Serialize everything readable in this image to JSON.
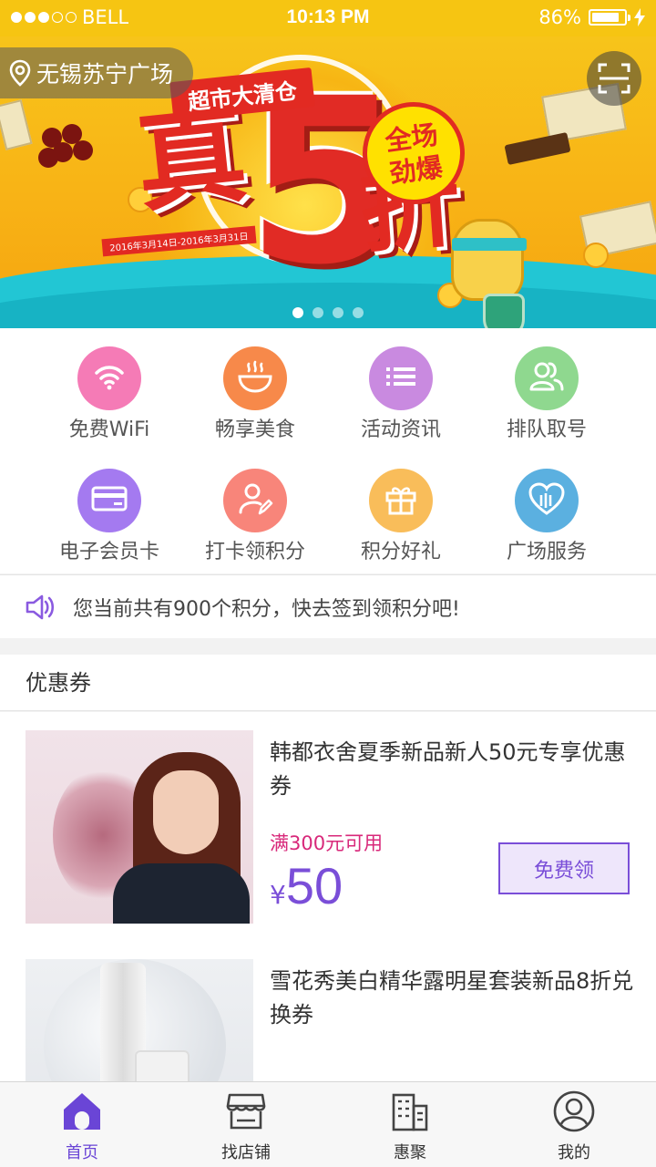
{
  "status_bar": {
    "carrier": "BELL",
    "signal_dots_filled": 3,
    "signal_dots_total": 5,
    "time": "10:13 PM",
    "battery_percent": "86%",
    "battery_level": 0.86
  },
  "banner": {
    "location": "无锡苏宁广场",
    "ribbon_text": "超市大清仓",
    "headline_zhen": "真",
    "headline_five": "5",
    "headline_zhe": "折",
    "badge_line1": "全场",
    "badge_line2": "劲爆",
    "date_range": "2016年3月14日-2016年3月31日",
    "page_count": 4,
    "active_page": 0
  },
  "services": [
    {
      "label": "免费WiFi",
      "icon": "wifi-icon",
      "color": "#f57bb6"
    },
    {
      "label": "畅享美食",
      "icon": "food-bowl-icon",
      "color": "#f7894a"
    },
    {
      "label": "活动资讯",
      "icon": "list-icon",
      "color": "#c98ae0"
    },
    {
      "label": "排队取号",
      "icon": "queue-people-icon",
      "color": "#8fd88f"
    },
    {
      "label": "电子会员卡",
      "icon": "member-card-icon",
      "color": "#a47af0"
    },
    {
      "label": "打卡领积分",
      "icon": "checkin-icon",
      "color": "#f8857a"
    },
    {
      "label": "积分好礼",
      "icon": "gift-icon",
      "color": "#f9bd5a"
    },
    {
      "label": "广场服务",
      "icon": "service-heart-icon",
      "color": "#5bb0e0"
    }
  ],
  "notice": {
    "text": "您当前共有900个积分，快去签到领积分吧!",
    "icon": "speaker-icon"
  },
  "coupons_section": {
    "title": "优惠券",
    "items": [
      {
        "title": "韩都衣舍夏季新品新人50元专享优惠券",
        "condition": "满300元可用",
        "currency": "¥",
        "amount": "50",
        "button": "免费领"
      },
      {
        "title": "雪花秀美白精华露明星套装新品8折兑换券"
      }
    ]
  },
  "tabbar": [
    {
      "label": "首页",
      "icon": "home-icon",
      "active": true
    },
    {
      "label": "找店铺",
      "icon": "store-icon",
      "active": false
    },
    {
      "label": "惠聚",
      "icon": "building-icon",
      "active": false
    },
    {
      "label": "我的",
      "icon": "profile-icon",
      "active": false
    }
  ],
  "colors": {
    "accent": "#7a4ed8",
    "status_bar": "#f6c512",
    "condition_text": "#d8287a"
  }
}
